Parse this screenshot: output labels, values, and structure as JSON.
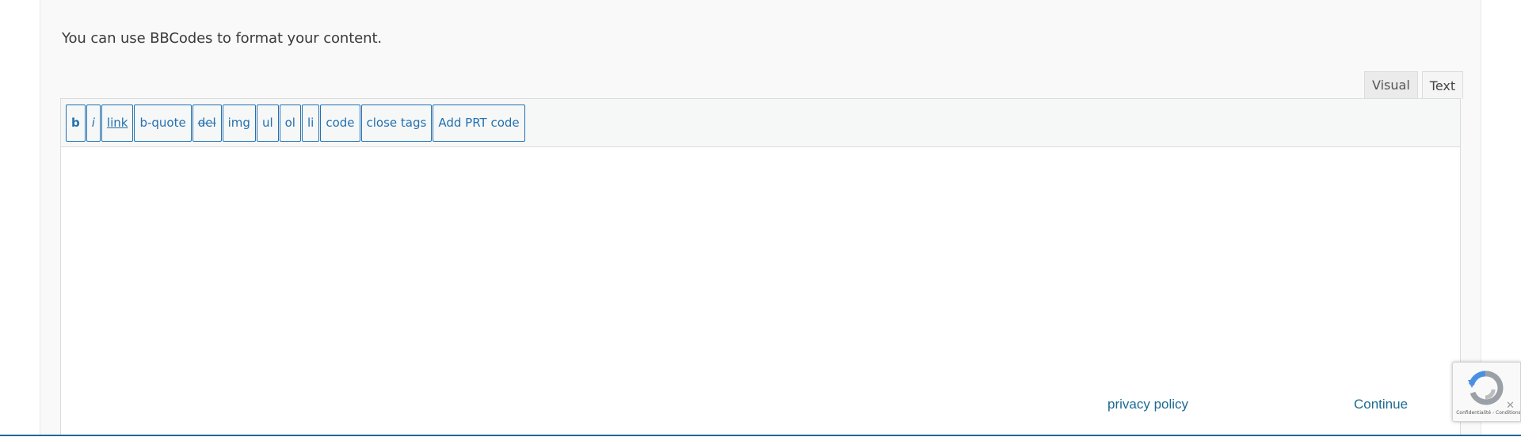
{
  "intro": {
    "text": "You can use BBCodes to format your content."
  },
  "editor": {
    "tabs": [
      {
        "label": "Visual"
      },
      {
        "label": "Text"
      }
    ],
    "toolbar": {
      "buttons": [
        {
          "label": "b"
        },
        {
          "label": "i"
        },
        {
          "label": "link"
        },
        {
          "label": "b-quote"
        },
        {
          "label": "del"
        },
        {
          "label": "img"
        },
        {
          "label": "ul"
        },
        {
          "label": "ol"
        },
        {
          "label": "li"
        },
        {
          "label": "code"
        },
        {
          "label": "close tags"
        },
        {
          "label": "Add PRT code"
        }
      ]
    },
    "content": ""
  },
  "footer": {
    "privacy_label": "privacy policy",
    "continue_label": "Continue"
  },
  "recaptcha": {
    "terms": "Confidentialité - Conditions"
  },
  "colors": {
    "accent": "#2271b1",
    "link": "#1b6a93",
    "panel_bg": "#f9f9f9"
  }
}
